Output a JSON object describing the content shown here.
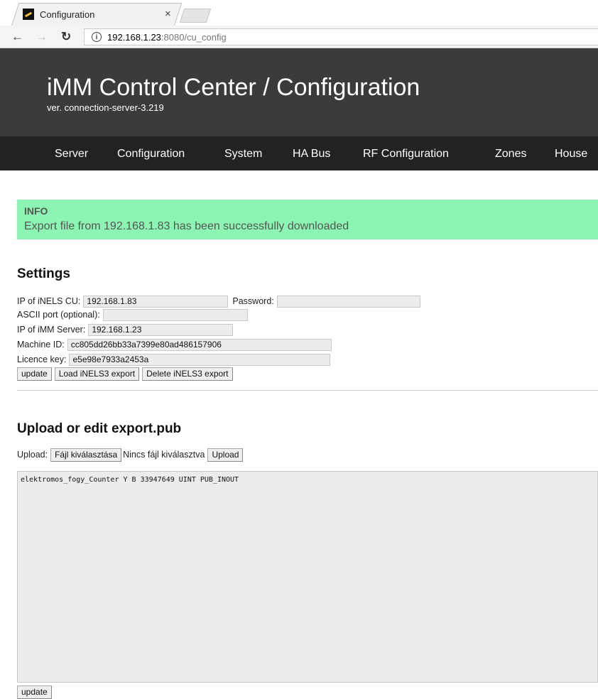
{
  "browser": {
    "tab_title": "Configuration",
    "tab_close": "×",
    "url_host": "192.168.1.23",
    "url_rest": ":8080/cu_config"
  },
  "header": {
    "title": "iMM Control Center / Configuration",
    "version": "ver. connection-server-3.219"
  },
  "nav": {
    "items": [
      "Server",
      "Configuration",
      "System",
      "HA Bus",
      "RF Configuration",
      "Zones",
      "House"
    ]
  },
  "info": {
    "title": "INFO",
    "message": "Export file from 192.168.1.83 has been successfully downloaded"
  },
  "settings": {
    "heading": "Settings",
    "ip_label": "IP of iNELS CU:",
    "ip_value": "192.168.1.83",
    "password_label": "Password:",
    "password_value": "",
    "ascii_label": "ASCII port (optional):",
    "ascii_value": "",
    "server_label": "IP of iMM Server:",
    "server_value": "192.168.1.23",
    "machine_label": "Machine ID:",
    "machine_value": "cc805dd26bb33a7399e80ad486157906",
    "licence_label": "Licence key:",
    "licence_value": "e5e98e7933a2453a",
    "update_button": "update",
    "load_button": "Load iNELS3 export",
    "delete_button": "Delete iNELS3 export"
  },
  "upload": {
    "heading": "Upload or edit export.pub",
    "upload_label": "Upload:",
    "choose_button": "Fájl kiválasztása",
    "no_file_text": "Nincs fájl kiválasztva",
    "upload_button": "Upload",
    "content": "elektromos_fogy_Counter Y B 33947649 UINT PUB_INOUT",
    "update_button": "update"
  },
  "icons": [
    "back-arrow-icon",
    "forward-arrow-icon",
    "reload-icon",
    "info-icon",
    "favicon-icon",
    "close-icon"
  ]
}
